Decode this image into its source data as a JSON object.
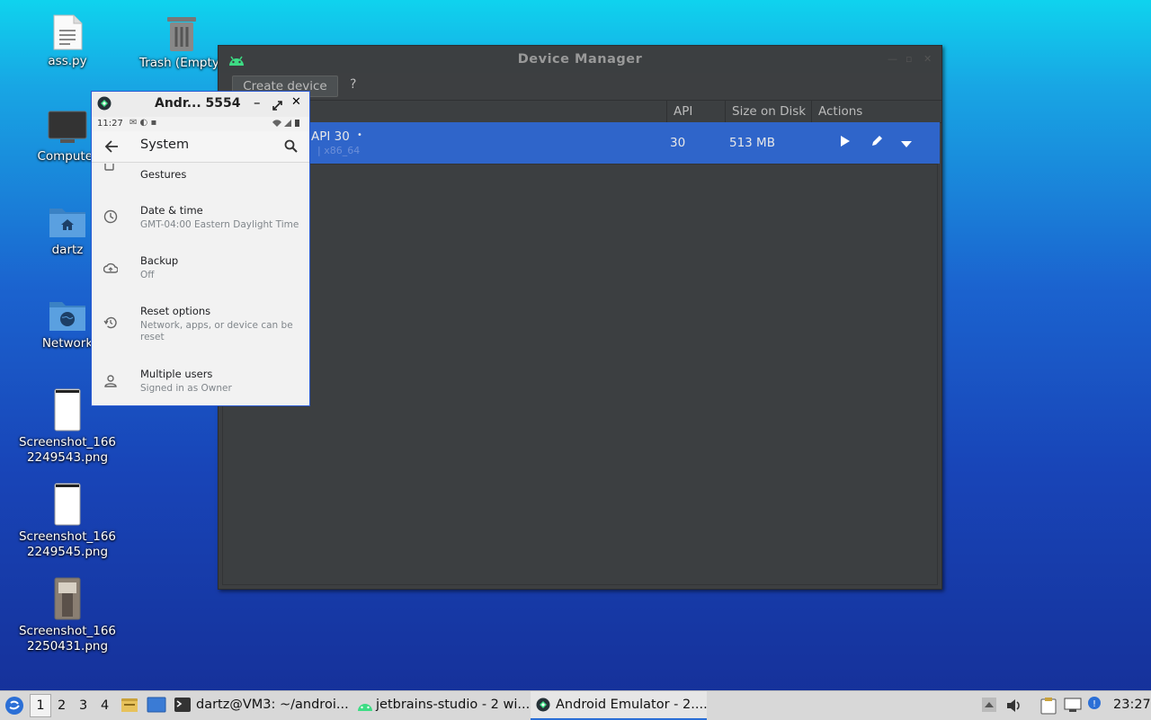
{
  "desktop": {
    "icons": [
      {
        "label": "ass.py"
      },
      {
        "label": "Trash (Empty)"
      },
      {
        "label": "Computer"
      },
      {
        "label": "dartz"
      },
      {
        "label": "Network"
      },
      {
        "label": "Screenshot_166\n2249543.png"
      },
      {
        "label": "Screenshot_166\n2249545.png"
      },
      {
        "label": "Screenshot_166\n2250431.png"
      }
    ]
  },
  "device_manager": {
    "title": "Device Manager",
    "create_device": "Create device",
    "help": "?",
    "columns": {
      "api": "API",
      "size": "Size on Disk",
      "actions": "Actions"
    },
    "row": {
      "name": "API 30",
      "sub": "| x86_64",
      "api": "30",
      "size": "513 MB"
    }
  },
  "emulator": {
    "title": "Andr... 5554",
    "time": "11:27",
    "screen_title": "System",
    "items": [
      {
        "title": "Gestures",
        "sub": ""
      },
      {
        "title": "Date & time",
        "sub": "GMT-04:00 Eastern Daylight Time"
      },
      {
        "title": "Backup",
        "sub": "Off"
      },
      {
        "title": "Reset options",
        "sub": "Network, apps, or device can be reset"
      },
      {
        "title": "Multiple users",
        "sub": "Signed in as Owner"
      }
    ]
  },
  "taskbar": {
    "workspaces": [
      "1",
      "2",
      "3",
      "4"
    ],
    "tasks": [
      {
        "label": "dartz@VM3: ~/androi..."
      },
      {
        "label": "jetbrains-studio - 2 wi..."
      },
      {
        "label": "Android Emulator - 2...."
      }
    ],
    "clock": "23:27"
  },
  "colors": {
    "selection": "#2f65ca",
    "android_green": "#3ddc84",
    "emulator_border": "#2b5ad2"
  }
}
